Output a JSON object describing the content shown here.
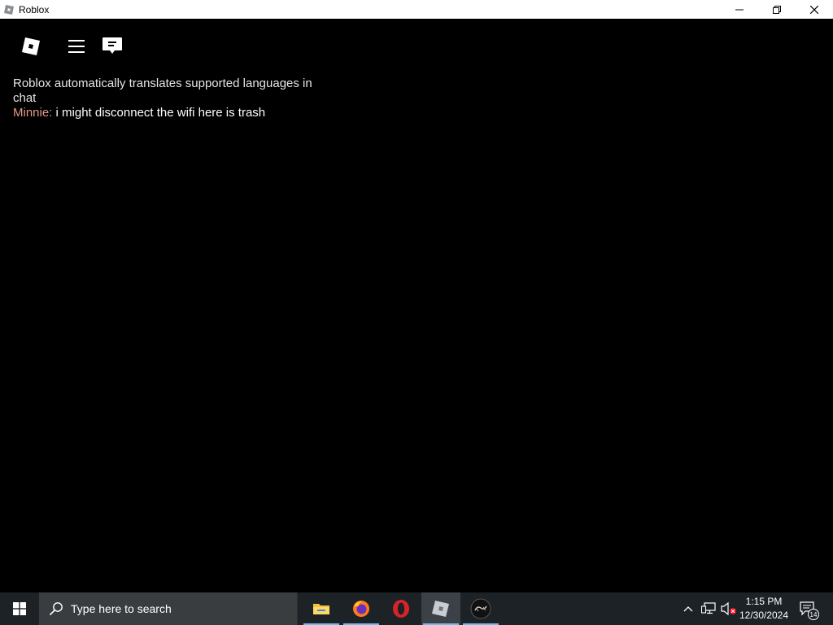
{
  "window": {
    "title": "Roblox",
    "controls": [
      "minimize",
      "restore",
      "close"
    ]
  },
  "roblox": {
    "topbar": {
      "logo_icon": "roblox-logo-icon",
      "menu_icon": "hamburger-menu-icon",
      "chat_icon": "chat-icon"
    },
    "chat": {
      "system_message": "Roblox automatically translates supported languages in chat",
      "messages": [
        {
          "author": "Minnie:",
          "text": "i might disconnect the wifi here is trash"
        }
      ]
    }
  },
  "taskbar": {
    "search_placeholder": "Type here to search",
    "apps": [
      {
        "name": "File Explorer",
        "icon": "file-explorer-icon"
      },
      {
        "name": "Firefox",
        "icon": "firefox-icon"
      },
      {
        "name": "Opera",
        "icon": "opera-icon"
      },
      {
        "name": "Roblox",
        "icon": "roblox-icon"
      },
      {
        "name": "App",
        "icon": "app-icon"
      }
    ],
    "tray": {
      "time": "1:15 PM",
      "date": "12/30/2024",
      "notification_count": "14"
    }
  },
  "colors": {
    "background": "#000000",
    "author_name": "#e39a84",
    "taskbar": "#1d2227",
    "accent": "#76b9ed"
  }
}
